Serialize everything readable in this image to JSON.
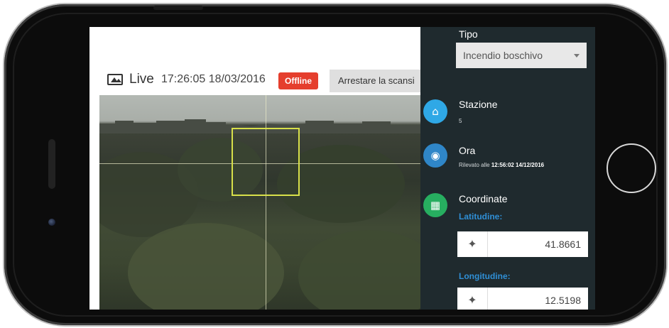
{
  "header": {
    "live_label": "Live",
    "live_timestamp": "17:26:05 18/03/2016",
    "status_badge": "Offline",
    "stop_button": "Arrestare la scansi"
  },
  "panel": {
    "tipo": {
      "label": "Tipo",
      "selected": "Incendio boschivo"
    },
    "stazione": {
      "title": "Stazione",
      "value": "5",
      "icon": "home-icon",
      "color": "#2fa8e6"
    },
    "ora": {
      "title": "Ora",
      "detected_prefix": "Rilevato alle",
      "detected_time": "12:56:02 14/12/2016",
      "icon": "clock-icon",
      "color": "#2f86c8"
    },
    "coordinate": {
      "title": "Coordinate",
      "icon": "map-icon",
      "color": "#27ae60",
      "lat_label": "Latitudine:",
      "lat_value": "41.8661",
      "lon_label": "Longitudine:",
      "lon_value": "12.5198",
      "locate_icon": "crosshair-icon"
    }
  },
  "colors": {
    "badge": "#e53e2d",
    "panel_bg": "#1f2a2e",
    "target_box": "#d8e04a",
    "coord_label": "#2f8fd6"
  }
}
